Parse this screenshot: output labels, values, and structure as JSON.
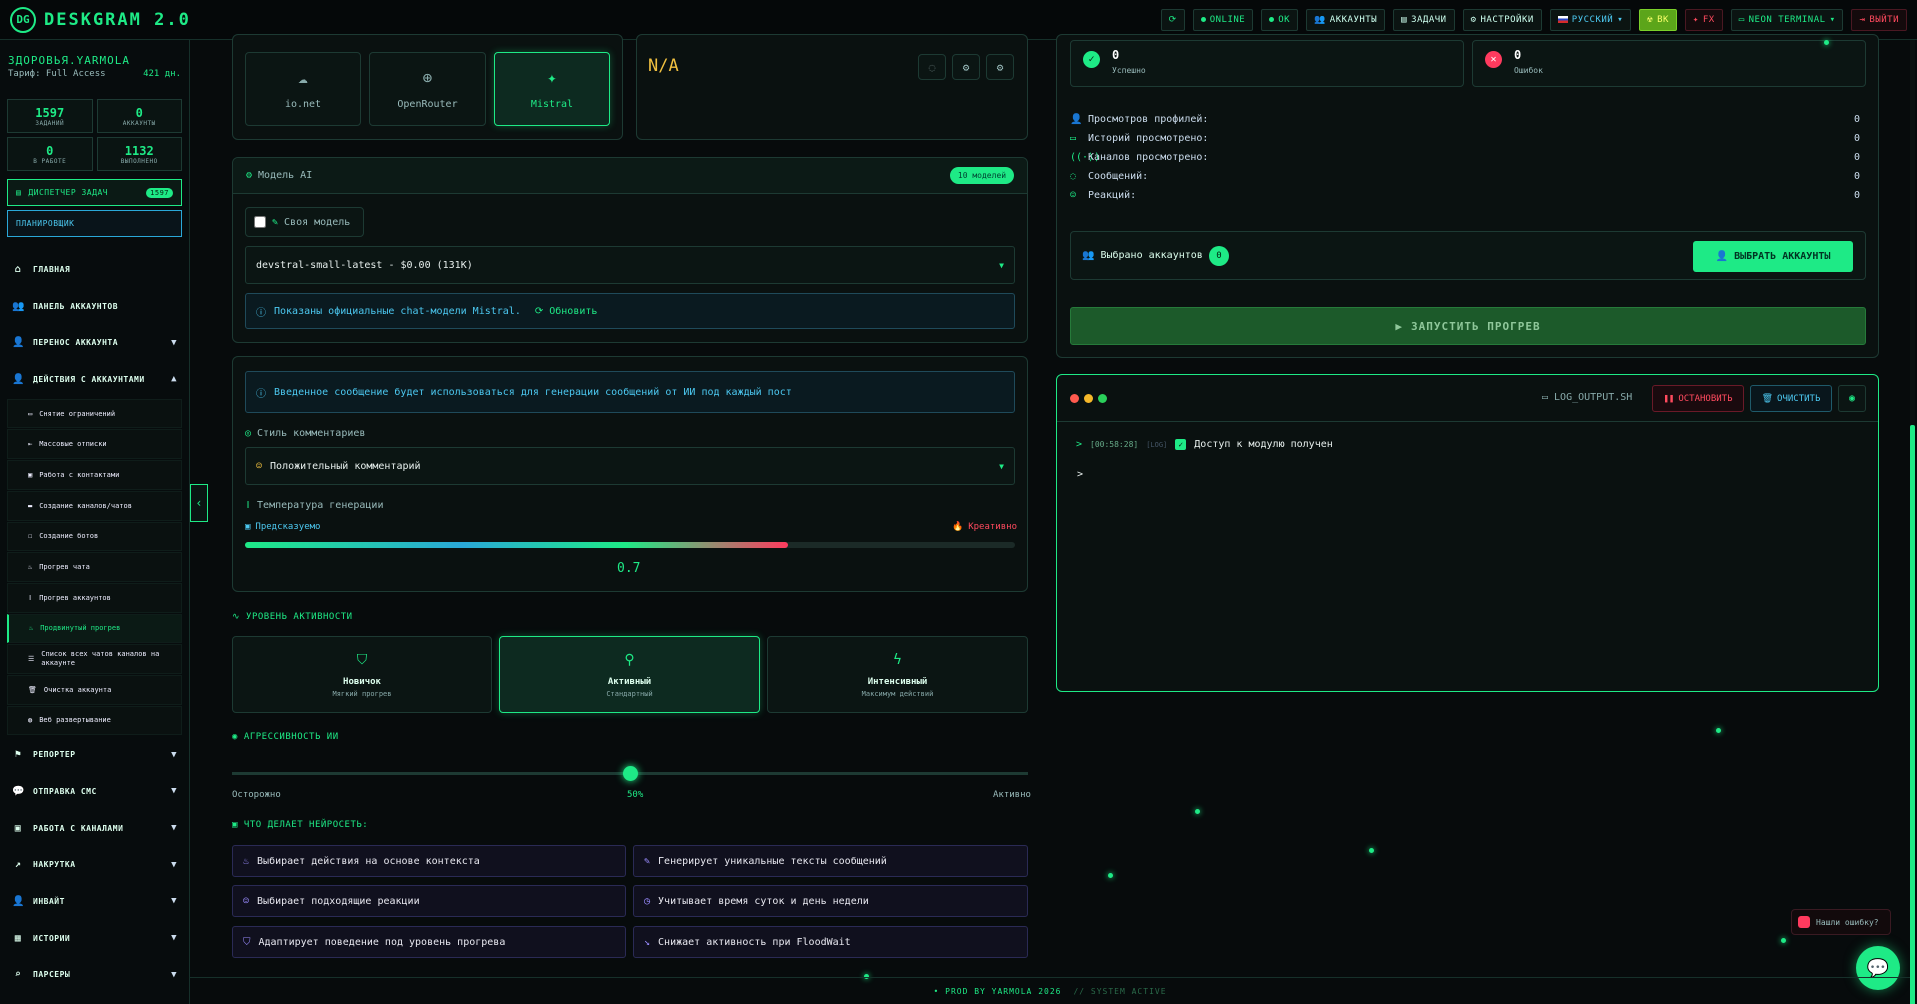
{
  "app": {
    "title": "DESKGRAM 2.0",
    "logo_mark": "DG"
  },
  "topbar": {
    "items": [
      {
        "label": "",
        "icon": "refresh-icon"
      },
      {
        "label": "ONLINE"
      },
      {
        "label": "OK"
      },
      {
        "label": "АККАУНТЫ"
      },
      {
        "label": "ЗАДАЧИ"
      },
      {
        "label": "НАСТРОЙКИ"
      },
      {
        "label": "РУССКИЙ"
      },
      {
        "label": "BK"
      },
      {
        "label": "FX"
      },
      {
        "label": "NEON TERMINAL"
      },
      {
        "label": "ВЫЙТИ"
      }
    ]
  },
  "user": {
    "name": "ЗДОРОВЬЯ.YARMOLA",
    "tariff": "Тариф: Full Access",
    "days": "421 дн."
  },
  "stats": [
    {
      "num": "1597",
      "label": "ЗАДАНИЙ"
    },
    {
      "num": "0",
      "label": "АККАУНТЫ"
    },
    {
      "num": "0",
      "label": "В РАБОТЕ"
    },
    {
      "num": "1132",
      "label": "ВЫПОЛНЕНО"
    }
  ],
  "dispatcher": {
    "label": "ДИСПЕТЧЕР ЗАДАЧ",
    "badge": "1597"
  },
  "scheduler": {
    "label": "ПЛАНИРОВЩИК"
  },
  "nav": {
    "main": "ГЛАВНАЯ",
    "panel": "ПАНЕЛЬ АККАУНТОВ",
    "transfer": "ПЕРЕНОС АККАУНТА",
    "actions": "ДЕЙСТВИЯ С АККАУНТАМИ",
    "sub": [
      "Снятие ограничений",
      "Массовые отписки",
      "Работа с контактами",
      "Создание каналов/чатов",
      "Создание ботов",
      "Прогрев чата",
      "Прогрев аккаунтов",
      "Продвинутый прогрев",
      "Список всех чатов каналов на аккаунте",
      "Очистка аккаунта",
      "Веб развертывание"
    ],
    "reporter": "РЕПОРТЕР",
    "sms": "ОТПРАВКА СМС",
    "channels": "РАБОТА С КАНАЛАМИ",
    "boost": "НАКРУТКА",
    "invite": "ИНВАЙТ",
    "stories": "ИСТОРИИ",
    "parsers": "ПАРСЕРЫ"
  },
  "providers": [
    {
      "name": "io.net",
      "icon": "cloud-icon"
    },
    {
      "name": "OpenRouter",
      "icon": "globe-icon"
    },
    {
      "name": "Mistral",
      "icon": "sparkle-icon",
      "active": true
    }
  ],
  "provider_status": "N/A",
  "model": {
    "title": "Модель AI",
    "count_badge": "10 моделей",
    "custom_label": "Своя модель",
    "custom_checked": false,
    "selected": "devstral-small-latest - $0.00 (131K)",
    "info": "Показаны официальные chat-модели Mistral.",
    "refresh": "Обновить"
  },
  "comments": {
    "info": "Введенное сообщение будет использоваться для генерации сообщений от ИИ под каждый пост",
    "style_label": "Стиль комментариев",
    "style_value": "Положительный комментарий",
    "temp_label": "Температура генерации",
    "temp_left": "Предсказуемо",
    "temp_right": "Креативно",
    "temp_fill": 0.705,
    "temp_value": "0.7"
  },
  "activity": {
    "title": "УРОВЕНЬ АКТИВНОСТИ",
    "levels": [
      {
        "t": "Новичок",
        "s": "Мягкий прогрев",
        "icon": "shield-icon"
      },
      {
        "t": "Активный",
        "s": "Стандартный",
        "icon": "walker-icon",
        "active": true
      },
      {
        "t": "Интенсивный",
        "s": "Максимум действий",
        "icon": "bolt-icon"
      }
    ]
  },
  "aggr": {
    "title": "АГРЕССИВНОСТЬ ИИ",
    "left": "Осторожно",
    "mid": "50%",
    "right": "Активно",
    "value": 0.5
  },
  "features": {
    "title": "ЧТО ДЕЛАЕТ НЕЙРОСЕТЬ:",
    "items": [
      "Выбирает действия на основе контекста",
      "Генерирует уникальные тексты сообщений",
      "Выбирает подходящие реакции",
      "Учитывает время суток и день недели",
      "Адаптирует поведение под уровень прогрева",
      "Снижает активность при FloodWait"
    ]
  },
  "results": {
    "success_label": "Успешно",
    "success_val": "0",
    "error_label": "Ошибок",
    "error_val": "0"
  },
  "counters": [
    {
      "label": "Просмотров профилей:",
      "value": "0"
    },
    {
      "label": "Историй просмотрено:",
      "value": "0"
    },
    {
      "label": "Каналов просмотрено:",
      "value": "0"
    },
    {
      "label": "Сообщений:",
      "value": "0"
    },
    {
      "label": "Реакций:",
      "value": "0"
    }
  ],
  "selected_accounts": {
    "label": "Выбрано аккаунтов",
    "count": "0",
    "button": "ВЫБРАТЬ АККАУНТЫ"
  },
  "launch": "ЗАПУСТИТЬ ПРОГРЕВ",
  "log": {
    "file": "LOG_OUTPUT.SH",
    "stop": "ОСТАНОВИТЬ",
    "clear": "ОЧИСТИТЬ",
    "time": "[00:58:28]",
    "tag": "[LOG]",
    "message": "Доступ к модулю получен",
    "prompt": ">"
  },
  "footer": {
    "text": "PROD BY YARMOLA 2026",
    "status": "// SYSTEM ACTIVE"
  },
  "bug_report": "Нашли ошибку?"
}
